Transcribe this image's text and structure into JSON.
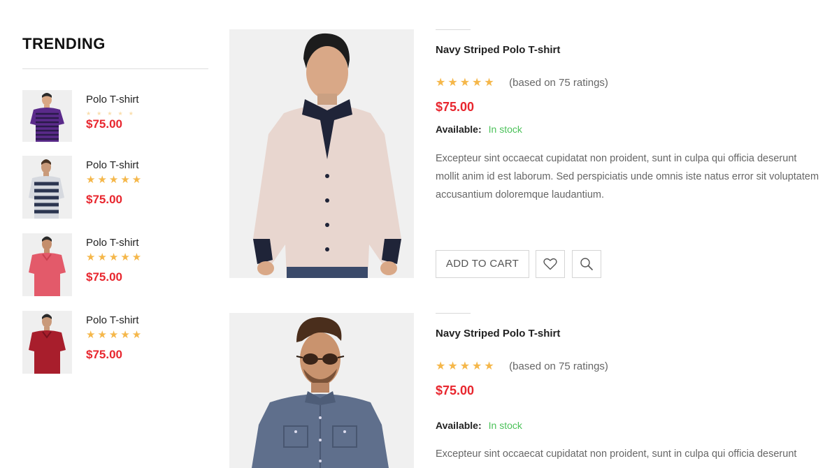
{
  "sidebar": {
    "title": "TRENDING",
    "items": [
      {
        "name": "Polo T-shirt",
        "stars": "★★★★★",
        "price": "$75.00"
      },
      {
        "name": "Polo T-shirt",
        "stars": "★★★★★",
        "price": "$75.00"
      },
      {
        "name": "Polo T-shirt",
        "stars": "★★★★★",
        "price": "$75.00"
      },
      {
        "name": "Polo T-shirt",
        "stars": "★★★★★",
        "price": "$75.00"
      }
    ]
  },
  "products": [
    {
      "title": "Navy Striped Polo T-shirt",
      "stars": "★★★★★",
      "rating_text": "(based on 75 ratings)",
      "price": "$75.00",
      "available_label": "Available:",
      "available_value": "In stock",
      "description": "Excepteur sint occaecat cupidatat non proident, sunt in culpa qui officia deserunt mollit anim id est laborum. Sed perspiciatis unde omnis iste natus error sit voluptatem accusantium doloremque laudantium.",
      "add_to_cart": "ADD TO CART"
    },
    {
      "title": "Navy Striped Polo T-shirt",
      "stars": "★★★★★",
      "rating_text": "(based on 75 ratings)",
      "price": "$75.00",
      "available_label": "Available:",
      "available_value": "In stock",
      "description": "Excepteur sint occaecat cupidatat non proident, sunt in culpa qui officia deserunt"
    }
  ],
  "icons": {
    "wishlist": "heart-icon",
    "quick_view": "search-icon",
    "rating": "star-icon"
  },
  "colors": {
    "price": "#e8262e",
    "stars": "#f5b74a",
    "in_stock": "#4cc25a",
    "border": "#d5d5d5"
  }
}
